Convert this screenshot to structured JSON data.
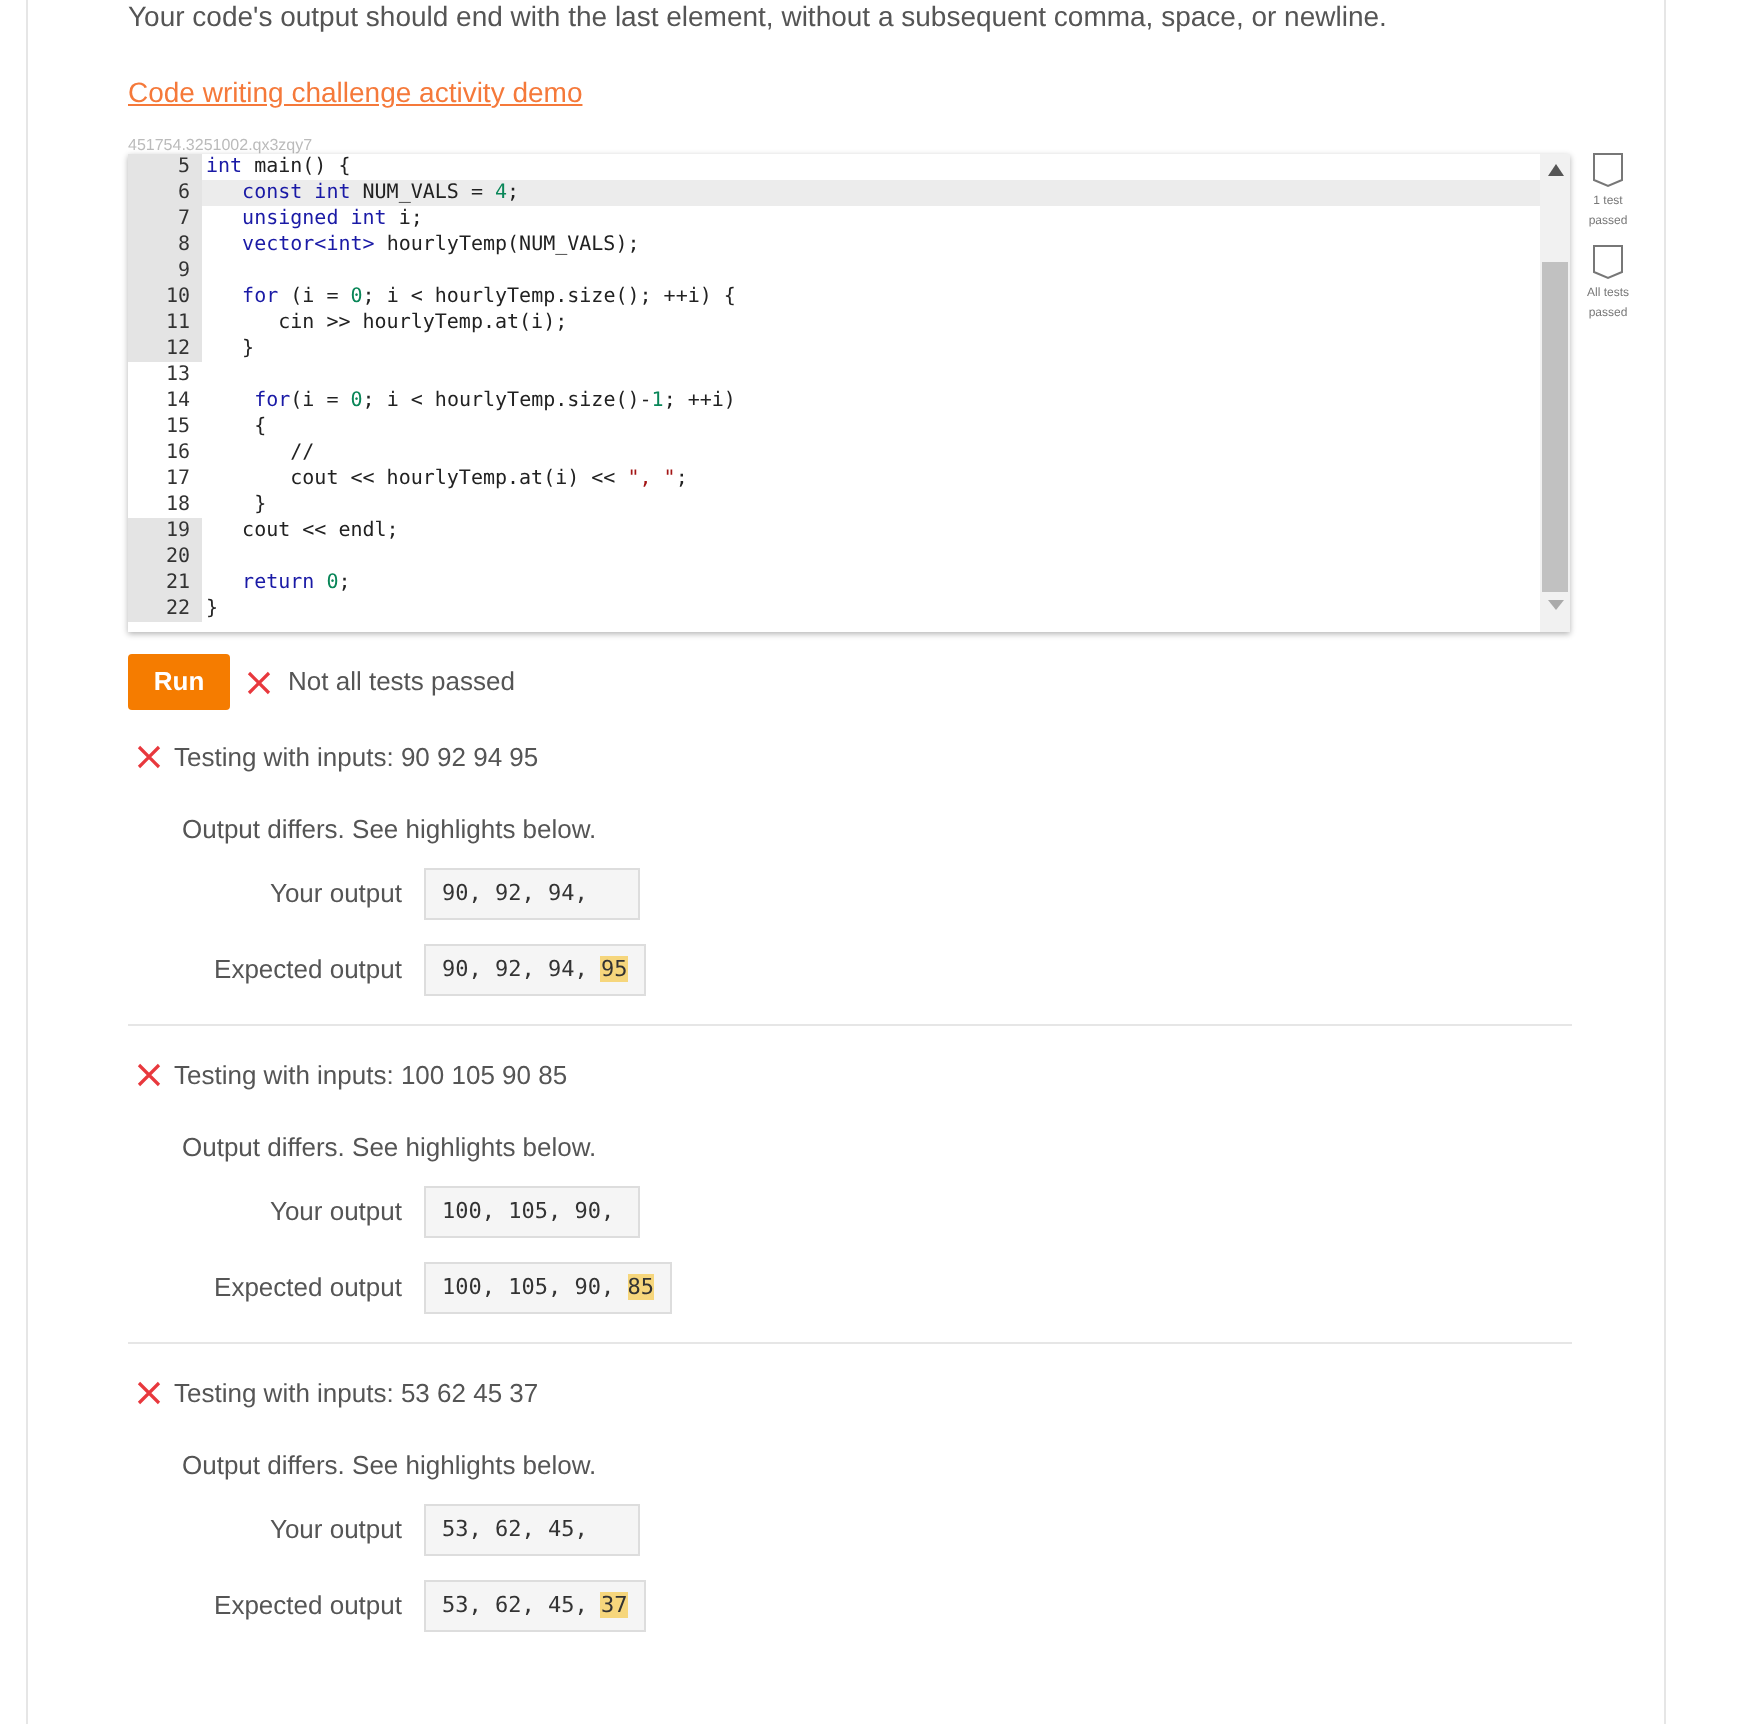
{
  "instructions": "Your code's output should end with the last element, without a subsequent comma, space, or newline.",
  "activity_link": "Code writing challenge activity demo",
  "activity_id": "451754.3251002.qx3zqy7",
  "code_lines": [
    {
      "number": "5",
      "shaded": true,
      "active": false,
      "tokens": [
        {
          "kind": "keyword",
          "text": "int"
        },
        {
          "kind": "plain",
          "text": " main() {"
        }
      ]
    },
    {
      "number": "6",
      "shaded": true,
      "active": true,
      "tokens": [
        {
          "kind": "keyword",
          "text": "   const int"
        },
        {
          "kind": "plain",
          "text": " NUM_VALS = "
        },
        {
          "kind": "number",
          "text": "4"
        },
        {
          "kind": "plain",
          "text": ";"
        }
      ]
    },
    {
      "number": "7",
      "shaded": true,
      "active": false,
      "tokens": [
        {
          "kind": "keyword",
          "text": "   unsigned int"
        },
        {
          "kind": "plain",
          "text": " i;"
        }
      ]
    },
    {
      "number": "8",
      "shaded": true,
      "active": false,
      "tokens": [
        {
          "kind": "keyword",
          "text": "   vector<int>"
        },
        {
          "kind": "plain",
          "text": " hourlyTemp(NUM_VALS);"
        }
      ]
    },
    {
      "number": "9",
      "shaded": true,
      "active": false
    },
    {
      "number": "10",
      "shaded": true,
      "active": false,
      "tokens": [
        {
          "kind": "keyword",
          "text": "   for"
        },
        {
          "kind": "plain",
          "text": " (i = "
        },
        {
          "kind": "number",
          "text": "0"
        },
        {
          "kind": "plain",
          "text": "; i < hourlyTemp.size(); ++i) {"
        }
      ]
    },
    {
      "number": "11",
      "shaded": true,
      "active": false,
      "tokens": [
        {
          "kind": "plain",
          "text": "      cin >> hourlyTemp.at(i);"
        }
      ]
    },
    {
      "number": "12",
      "shaded": true,
      "active": false,
      "tokens": [
        {
          "kind": "plain",
          "text": "   }"
        }
      ]
    },
    {
      "number": "13",
      "shaded": false,
      "active": false
    },
    {
      "number": "14",
      "shaded": false,
      "active": false,
      "tokens": [
        {
          "kind": "keyword",
          "text": "    for"
        },
        {
          "kind": "plain",
          "text": "(i = "
        },
        {
          "kind": "number",
          "text": "0"
        },
        {
          "kind": "plain",
          "text": "; i < hourlyTemp.size()-"
        },
        {
          "kind": "number",
          "text": "1"
        },
        {
          "kind": "plain",
          "text": "; ++i)"
        }
      ]
    },
    {
      "number": "15",
      "shaded": false,
      "active": false,
      "tokens": [
        {
          "kind": "plain",
          "text": "    {"
        }
      ]
    },
    {
      "number": "16",
      "shaded": false,
      "active": false,
      "tokens": [
        {
          "kind": "plain",
          "text": "       //"
        }
      ]
    },
    {
      "number": "17",
      "shaded": false,
      "active": false,
      "tokens": [
        {
          "kind": "plain",
          "text": "       cout << hourlyTemp.at(i) << "
        },
        {
          "kind": "string",
          "text": "\", \""
        },
        {
          "kind": "plain",
          "text": ";"
        }
      ]
    },
    {
      "number": "18",
      "shaded": false,
      "active": false,
      "tokens": [
        {
          "kind": "plain",
          "text": "    }"
        }
      ]
    },
    {
      "number": "19",
      "shaded": true,
      "active": false,
      "tokens": [
        {
          "kind": "plain",
          "text": "   cout << endl;"
        }
      ]
    },
    {
      "number": "20",
      "shaded": true,
      "active": false
    },
    {
      "number": "21",
      "shaded": true,
      "active": false,
      "tokens": [
        {
          "kind": "keyword",
          "text": "   return"
        },
        {
          "kind": "number",
          "text": " 0"
        },
        {
          "kind": "plain",
          "text": ";"
        }
      ]
    },
    {
      "number": "22",
      "shaded": true,
      "active": false,
      "tokens": [
        {
          "kind": "plain",
          "text": "}"
        }
      ]
    }
  ],
  "badges": [
    {
      "label": "1 test passed",
      "passed": false
    },
    {
      "label": "All tests passed",
      "passed": false
    }
  ],
  "run_button": "Run",
  "overall": {
    "passed": false,
    "text": "Not all tests passed"
  },
  "tests": [
    {
      "passed": false,
      "title": "Testing with inputs: 90 92 94 95",
      "message": "Output differs. See highlights below.",
      "your_label": "Your output",
      "your_output": "90, 92, 94,",
      "expected_label": "Expected output",
      "expected": [
        {
          "text": "90, 92, 94, ",
          "highlight": false
        },
        {
          "text": "95",
          "highlight": true
        }
      ]
    },
    {
      "passed": false,
      "title": "Testing with inputs: 100 105 90 85",
      "message": "Output differs. See highlights below.",
      "your_label": "Your output",
      "your_output": "100, 105, 90,",
      "expected_label": "Expected output",
      "expected": [
        {
          "text": "100, 105, 90, ",
          "highlight": false
        },
        {
          "text": "85",
          "highlight": true
        }
      ]
    },
    {
      "passed": false,
      "title": "Testing with inputs: 53 62 45 37",
      "message": "Output differs. See highlights below.",
      "your_label": "Your output",
      "your_output": "53, 62, 45,",
      "expected_label": "Expected output",
      "expected": [
        {
          "text": "53, 62, 45, ",
          "highlight": false
        },
        {
          "text": "37",
          "highlight": true
        }
      ]
    }
  ]
}
